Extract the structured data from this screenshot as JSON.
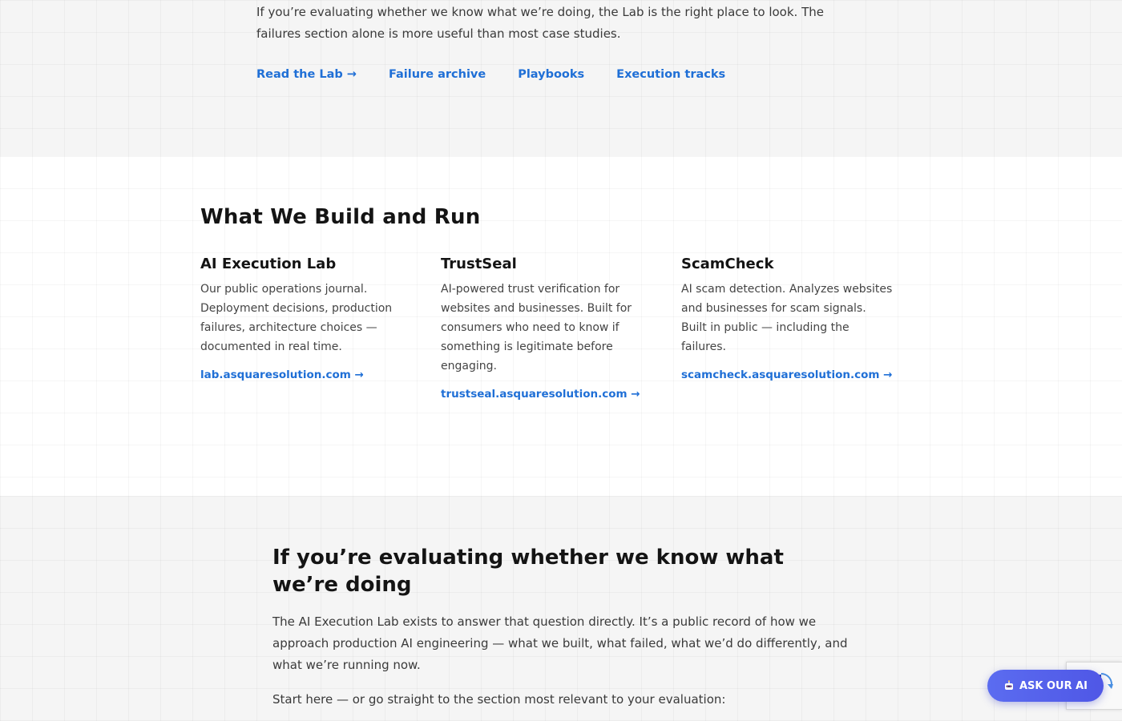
{
  "intro_section": {
    "text": "If you’re evaluating whether we know what we’re doing, the Lab is the right place to look. The failures section alone is more useful than most case studies.",
    "links": [
      {
        "label": "Read the Lab →"
      },
      {
        "label": "Failure archive"
      },
      {
        "label": "Playbooks"
      },
      {
        "label": "Execution tracks"
      }
    ]
  },
  "build_section": {
    "heading": "What We Build and Run",
    "cards": [
      {
        "title": "AI Execution Lab",
        "description": "Our public operations journal. Deployment decisions, production failures, architecture choices — documented in real time.",
        "link": "lab.asquaresolution.com →"
      },
      {
        "title": "TrustSeal",
        "description": "AI-powered trust verification for websites and businesses. Built for consumers who need to know if something is legitimate before engaging.",
        "link": "trustseal.asquaresolution.com →"
      },
      {
        "title": "ScamCheck",
        "description": "AI scam detection. Analyzes websites and businesses for scam signals. Built in public — including the failures.",
        "link": "scamcheck.asquaresolution.com →"
      }
    ]
  },
  "evaluate_section": {
    "heading": "If you’re evaluating whether we know what we’re doing",
    "body": "The AI Execution Lab exists to answer that question directly. It’s a public record of how we approach production AI engineering — what we built, what failed, what we’d do differently, and what we’re running now.",
    "start_text": "Start here — or go straight to the section most relevant to your evaluation:"
  },
  "chat_widget": {
    "label": "ASK OUR AI",
    "icon": "robot-icon",
    "colors": {
      "from": "#5b6cf0",
      "to": "#4f57e6"
    }
  },
  "colors": {
    "link": "#1f6fd6",
    "section_alt_bg": "#f5f5f5"
  }
}
